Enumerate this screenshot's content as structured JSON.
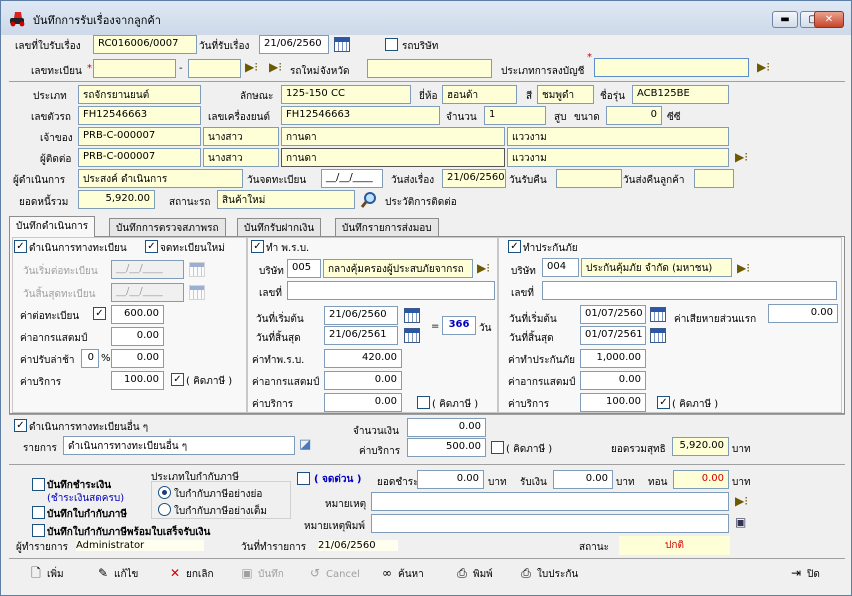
{
  "window": {
    "title": "บันทึกการรับเรื่องจากลูกค้า",
    "min": "▬",
    "max": "▢",
    "close": "✕"
  },
  "icons": {
    "calendar": "calendar-icon",
    "picker": "picker-icon"
  },
  "top": {
    "receipt_no_label": "เลขที่ใบรับเรื่อง",
    "receipt_no": "RC016006/0007",
    "receipt_date_label": "วันที่รับเรื่อง",
    "receipt_date": "21/06/2560",
    "company_car_label": "รถบริษัท",
    "reg_label": "เลขทะเบียน",
    "reg_part1": "",
    "reg_dash": "-",
    "reg_part2": "",
    "new_car_label": "รถใหม่",
    "province_label": "จังหวัด",
    "province": "",
    "account_type_label": "ประเภทการลงบัญชี",
    "account_type": ""
  },
  "vehicle": {
    "type_label": "ประเภท",
    "type": "รถจักรยานยนต์",
    "style_label": "ลักษณะ",
    "style": "125-150 CC",
    "brand_label": "ยี่ห้อ",
    "brand": "ฮอนด้า",
    "color_label": "สี",
    "color": "ชมพูดำ",
    "model_label": "ชื่อรุ่น",
    "model": "ACB125BE",
    "chassis_label": "เลขตัวรถ",
    "chassis": "FH12546663",
    "engine_label": "เลขเครื่องยนต์",
    "engine": "FH12546663",
    "qty_label": "จำนวน",
    "qty": "1",
    "cylinder_label": "สูบ",
    "size_label": "ขนาด",
    "size": "0",
    "cc_label": "ซีซี",
    "owner_label": "เจ้าของ",
    "owner_id": "PRB-C-000007",
    "owner_title": "นางสาว",
    "owner_first": "กานดา",
    "owner_last": "แววงาม",
    "contact_label": "ผู้ติดต่อ",
    "contact_id": "PRB-C-000007",
    "contact_title": "นางสาว",
    "contact_first": "กานดา",
    "contact_last": "แววงาม",
    "operator_label": "ผู้ดำเนินการ",
    "operator": "ประสงค์ ดำเนินการ",
    "regdate_label": "วันจดทะเบียน",
    "regdate": "__/__/____",
    "send_label": "วันส่งเรื่อง",
    "send": "21/06/2560",
    "return_label": "วันรับคืน",
    "return": "",
    "return_cust_label": "วันส่งคืนลูกค้า",
    "return_cust": "",
    "net_label": "ยอดหนี้รวม",
    "net": "5,920.00",
    "status_label": "สถานะรถ",
    "status": "สินค้าใหม่",
    "history_label": "ประวัติการติดต่อ"
  },
  "tabs": [
    "บันทึกดำเนินการ",
    "บันทึกการตรวจสภาพรถ",
    "บันทึกรับฝากเงิน",
    "บันทึกรายการส่งมอบ"
  ],
  "reg": {
    "title": "ดำเนินการทางทะเบียน",
    "new_reg": "จดทะเบียนใหม่",
    "renew_start_label": "วันเริ่มต่อทะเบียน",
    "renew_start": "__/__/____",
    "renew_end_label": "วันสิ้นสุดทะเบียน",
    "renew_end": "__/__/____",
    "fee_label": "ค่าต่อทะเบียน",
    "fee": "600.00",
    "stamp_label": "ค่าอากรแสตมป์",
    "stamp": "0.00",
    "fine_label": "ค่าปรับล่าช้า",
    "fine_pct": "0",
    "pct": "%",
    "fine": "0.00",
    "service_label": "ค่าบริการ",
    "service": "100.00",
    "tax_label": "( คิดภาษี )"
  },
  "cmi": {
    "title": "ทำ พ.ร.บ.",
    "company_label": "บริษัท",
    "company_code": "005",
    "company_name": "กลางคุ้มครองผู้ประสบภัยจากรถ",
    "no_label": "เลขที่",
    "no": "",
    "start_label": "วันที่เริ่มต้น",
    "start": "21/06/2560",
    "end_label": "วันที่สิ้นสุด",
    "end": "21/06/2561",
    "eq": "=",
    "days": "366",
    "days_label": "วัน",
    "premium_label": "ค่าทำพ.ร.บ.",
    "premium": "420.00",
    "stamp_label": "ค่าอากรแสตมป์",
    "stamp": "0.00",
    "service_label": "ค่าบริการ",
    "service": "0.00",
    "tax_label": "( คิดภาษี )"
  },
  "ins": {
    "title": "ทำประกันภัย",
    "company_label": "บริษัท",
    "company_code": "004",
    "company_name": "ประกันคุ้มภัย จำกัด (มหาชน)",
    "no_label": "เลขที่",
    "no": "",
    "start_label": "วันที่เริ่มต้น",
    "start": "01/07/2560",
    "end_label": "วันที่สิ้นสุด",
    "end": "01/07/2561",
    "deduct_label": "ค่าเสียหายส่วนแรก",
    "deduct": "0.00",
    "premium_label": "ค่าทำประกันภัย",
    "premium": "1,000.00",
    "stamp_label": "ค่าอากรแสตมป์",
    "stamp": "0.00",
    "service_label": "ค่าบริการ",
    "service": "100.00",
    "tax_label": "( คิดภาษี )"
  },
  "other": {
    "title": "ดำเนินการทางทะเบียนอื่น ๆ",
    "item_label": "รายการ",
    "item": "ดำเนินการทางทะเบียนอื่น ๆ",
    "amount_label": "จำนวนเงิน",
    "amount": "0.00",
    "service_label": "ค่าบริการ",
    "service": "500.00",
    "tax_label": "( คิดภาษี )",
    "total_label": "ยอดรวมสุทธิ",
    "total": "5,920.00",
    "baht": "บาท"
  },
  "bottom": {
    "pay_label": "บันทึกชำระเงิน",
    "pay_link": "(ชำระเงินสดครบ)",
    "invoice_label": "บันทึกใบกำกับภาษี",
    "invoice_receipt_label": "บันทึกใบกำกับภาษีพร้อมใบเสร็จรับเงิน",
    "taxtype_label": "ประเภทใบกำกับภาษี",
    "tax_short": "ใบกำกับภาษีอย่างย่อ",
    "tax_full": "ใบกำกับภาษีอย่างเต็ม",
    "urgent_label": "( จดด่วน )",
    "due_label": "ยอดชำระ",
    "due": "0.00",
    "received_label": "รับเงิน",
    "received": "0.00",
    "change_label": "ทอน",
    "change": "0.00",
    "baht": "บาท",
    "note_label": "หมายเหตุ",
    "note": "",
    "print_note_label": "หมายเหตุพิมพ์",
    "print_note": "",
    "recorder_label": "ผู้ทำรายการ",
    "recorder": "Administrator",
    "txdate_label": "วันที่ทำรายการ",
    "txdate": "21/06/2560",
    "state_label": "สถานะ",
    "state": "ปกติ"
  },
  "toolbar": {
    "add": "เพิ่ม",
    "edit": "แก้ไข",
    "cancel_doc": "ยกเลิก",
    "save": "บันทึก",
    "cancel": "Cancel",
    "search": "ค้นหา",
    "print": "พิมพ์",
    "policy": "ใบประกัน",
    "close": "ปิด"
  },
  "colors": {
    "yellow_field": "#ffffd7",
    "link": "#0000c0",
    "accent_red": "#d00000"
  }
}
